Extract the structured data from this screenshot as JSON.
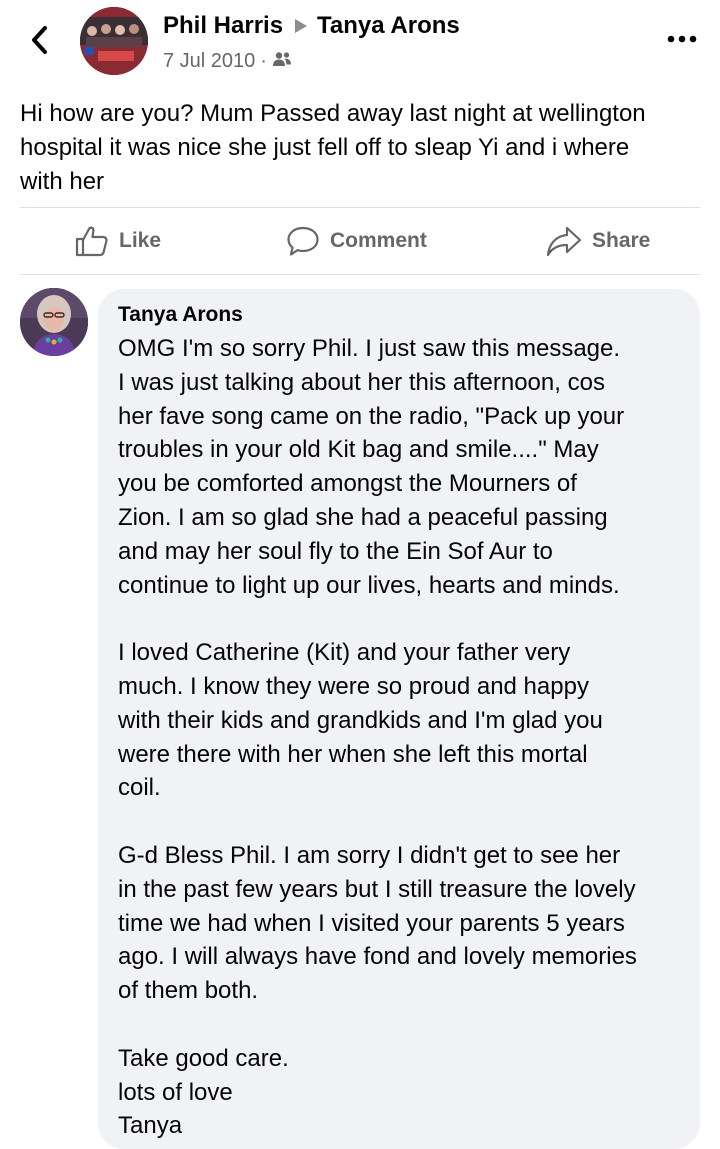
{
  "header": {
    "back_icon": "chevron-left-icon",
    "author": "Phil Harris",
    "target": "Tanya Arons",
    "date": "7 Jul 2010",
    "separator": "·",
    "audience_icon": "friends-icon",
    "more_icon": "more-horizontal-icon"
  },
  "post": {
    "text": "Hi how are you? Mum Passed away last night at wellington\nhospital it was nice she just fell off to sleap Yi and i where\nwith her"
  },
  "actions": {
    "like_label": "Like",
    "comment_label": "Comment",
    "share_label": "Share"
  },
  "comment": {
    "author": "Tanya Arons",
    "text": "OMG  I'm so sorry Phil.  I just saw this message.\nI was just talking about her this afternoon, cos\nher fave song came on the radio,  \"Pack up your\ntroubles in your old Kit bag and smile....\"  May\nyou be comforted amongst the Mourners of\nZion.  I am so glad she had a peaceful passing\nand may her soul fly to the Ein Sof Aur to\ncontinue to light up our lives, hearts and minds.\n\nI loved Catherine (Kit) and your father very\nmuch.  I know they were so proud and happy\nwith their kids and grandkids and I'm glad you\nwere there with her when she left this mortal\ncoil.\n\nG-d Bless Phil.  I am sorry I didn't get to see her\nin the past few years but I still treasure the lovely\ntime we had when I visited your parents 5 years\nago.  I will always have fond and lovely memories\nof them both.\n\nTake good care.\nlots of love\nTanya"
  },
  "colors": {
    "text_primary": "#050505",
    "text_secondary": "#65676b",
    "bubble_bg": "#f0f2f5",
    "divider": "#dcdfe3"
  }
}
